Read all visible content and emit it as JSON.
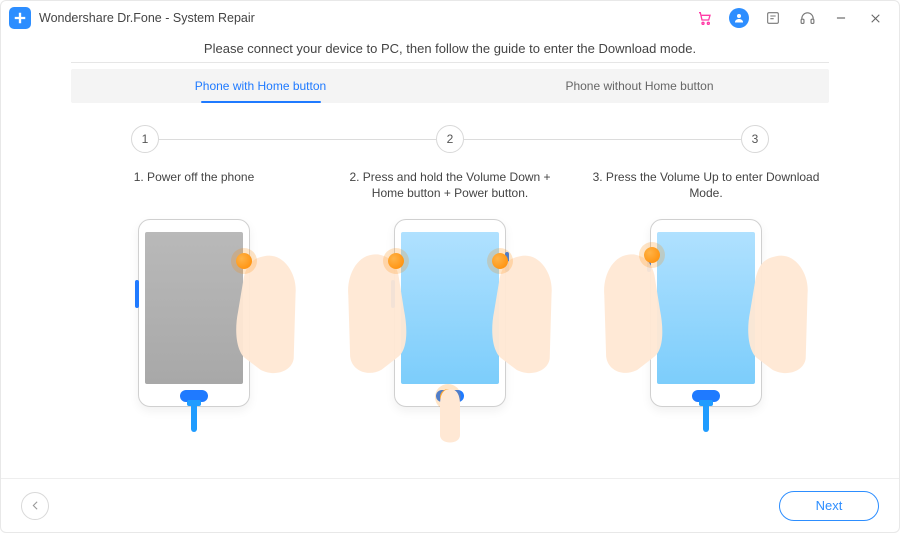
{
  "titlebar": {
    "title": "Wondershare Dr.Fone - System Repair"
  },
  "instruction": "Please connect your device to PC, then follow the guide to enter the Download mode.",
  "tabs": {
    "active": "Phone with Home button",
    "inactive": "Phone without Home button"
  },
  "stepper": {
    "n1": "1",
    "n2": "2",
    "n3": "3"
  },
  "steps": {
    "s1": "1. Power off the phone",
    "s2": "2. Press and hold the Volume Down + Home button + Power button.",
    "s3": "3. Press the Volume Up to enter Download Mode."
  },
  "footer": {
    "next": "Next"
  }
}
